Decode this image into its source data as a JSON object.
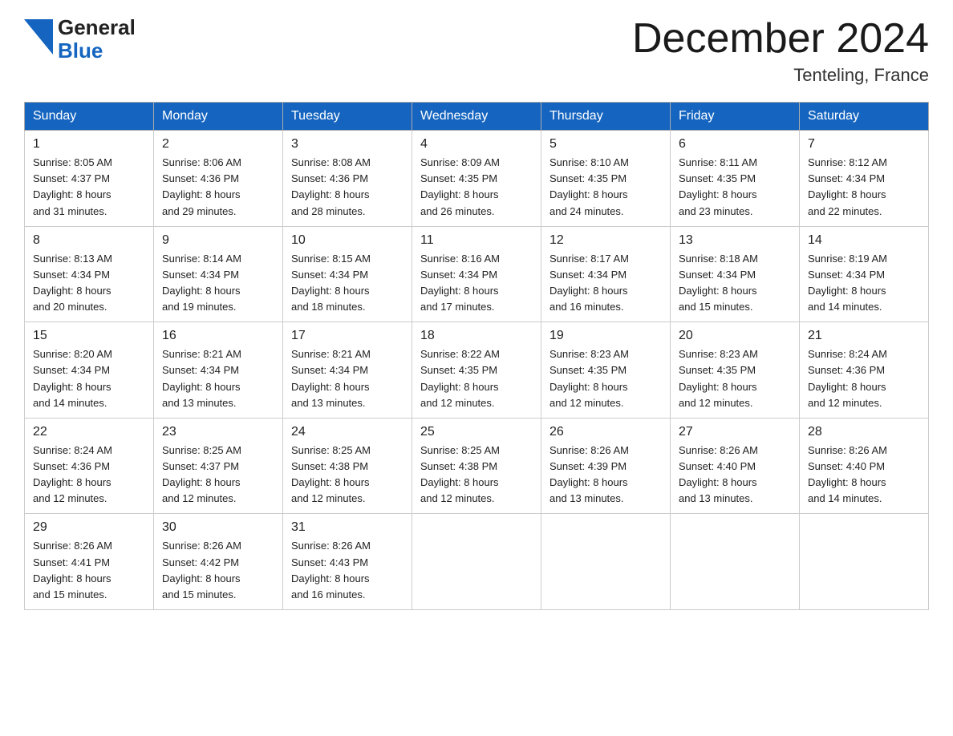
{
  "header": {
    "logo_line1": "General",
    "logo_line2": "Blue",
    "month_title": "December 2024",
    "location": "Tenteling, France"
  },
  "calendar": {
    "headers": [
      "Sunday",
      "Monday",
      "Tuesday",
      "Wednesday",
      "Thursday",
      "Friday",
      "Saturday"
    ],
    "weeks": [
      [
        {
          "day": "1",
          "info": "Sunrise: 8:05 AM\nSunset: 4:37 PM\nDaylight: 8 hours\nand 31 minutes."
        },
        {
          "day": "2",
          "info": "Sunrise: 8:06 AM\nSunset: 4:36 PM\nDaylight: 8 hours\nand 29 minutes."
        },
        {
          "day": "3",
          "info": "Sunrise: 8:08 AM\nSunset: 4:36 PM\nDaylight: 8 hours\nand 28 minutes."
        },
        {
          "day": "4",
          "info": "Sunrise: 8:09 AM\nSunset: 4:35 PM\nDaylight: 8 hours\nand 26 minutes."
        },
        {
          "day": "5",
          "info": "Sunrise: 8:10 AM\nSunset: 4:35 PM\nDaylight: 8 hours\nand 24 minutes."
        },
        {
          "day": "6",
          "info": "Sunrise: 8:11 AM\nSunset: 4:35 PM\nDaylight: 8 hours\nand 23 minutes."
        },
        {
          "day": "7",
          "info": "Sunrise: 8:12 AM\nSunset: 4:34 PM\nDaylight: 8 hours\nand 22 minutes."
        }
      ],
      [
        {
          "day": "8",
          "info": "Sunrise: 8:13 AM\nSunset: 4:34 PM\nDaylight: 8 hours\nand 20 minutes."
        },
        {
          "day": "9",
          "info": "Sunrise: 8:14 AM\nSunset: 4:34 PM\nDaylight: 8 hours\nand 19 minutes."
        },
        {
          "day": "10",
          "info": "Sunrise: 8:15 AM\nSunset: 4:34 PM\nDaylight: 8 hours\nand 18 minutes."
        },
        {
          "day": "11",
          "info": "Sunrise: 8:16 AM\nSunset: 4:34 PM\nDaylight: 8 hours\nand 17 minutes."
        },
        {
          "day": "12",
          "info": "Sunrise: 8:17 AM\nSunset: 4:34 PM\nDaylight: 8 hours\nand 16 minutes."
        },
        {
          "day": "13",
          "info": "Sunrise: 8:18 AM\nSunset: 4:34 PM\nDaylight: 8 hours\nand 15 minutes."
        },
        {
          "day": "14",
          "info": "Sunrise: 8:19 AM\nSunset: 4:34 PM\nDaylight: 8 hours\nand 14 minutes."
        }
      ],
      [
        {
          "day": "15",
          "info": "Sunrise: 8:20 AM\nSunset: 4:34 PM\nDaylight: 8 hours\nand 14 minutes."
        },
        {
          "day": "16",
          "info": "Sunrise: 8:21 AM\nSunset: 4:34 PM\nDaylight: 8 hours\nand 13 minutes."
        },
        {
          "day": "17",
          "info": "Sunrise: 8:21 AM\nSunset: 4:34 PM\nDaylight: 8 hours\nand 13 minutes."
        },
        {
          "day": "18",
          "info": "Sunrise: 8:22 AM\nSunset: 4:35 PM\nDaylight: 8 hours\nand 12 minutes."
        },
        {
          "day": "19",
          "info": "Sunrise: 8:23 AM\nSunset: 4:35 PM\nDaylight: 8 hours\nand 12 minutes."
        },
        {
          "day": "20",
          "info": "Sunrise: 8:23 AM\nSunset: 4:35 PM\nDaylight: 8 hours\nand 12 minutes."
        },
        {
          "day": "21",
          "info": "Sunrise: 8:24 AM\nSunset: 4:36 PM\nDaylight: 8 hours\nand 12 minutes."
        }
      ],
      [
        {
          "day": "22",
          "info": "Sunrise: 8:24 AM\nSunset: 4:36 PM\nDaylight: 8 hours\nand 12 minutes."
        },
        {
          "day": "23",
          "info": "Sunrise: 8:25 AM\nSunset: 4:37 PM\nDaylight: 8 hours\nand 12 minutes."
        },
        {
          "day": "24",
          "info": "Sunrise: 8:25 AM\nSunset: 4:38 PM\nDaylight: 8 hours\nand 12 minutes."
        },
        {
          "day": "25",
          "info": "Sunrise: 8:25 AM\nSunset: 4:38 PM\nDaylight: 8 hours\nand 12 minutes."
        },
        {
          "day": "26",
          "info": "Sunrise: 8:26 AM\nSunset: 4:39 PM\nDaylight: 8 hours\nand 13 minutes."
        },
        {
          "day": "27",
          "info": "Sunrise: 8:26 AM\nSunset: 4:40 PM\nDaylight: 8 hours\nand 13 minutes."
        },
        {
          "day": "28",
          "info": "Sunrise: 8:26 AM\nSunset: 4:40 PM\nDaylight: 8 hours\nand 14 minutes."
        }
      ],
      [
        {
          "day": "29",
          "info": "Sunrise: 8:26 AM\nSunset: 4:41 PM\nDaylight: 8 hours\nand 15 minutes."
        },
        {
          "day": "30",
          "info": "Sunrise: 8:26 AM\nSunset: 4:42 PM\nDaylight: 8 hours\nand 15 minutes."
        },
        {
          "day": "31",
          "info": "Sunrise: 8:26 AM\nSunset: 4:43 PM\nDaylight: 8 hours\nand 16 minutes."
        },
        {
          "day": "",
          "info": ""
        },
        {
          "day": "",
          "info": ""
        },
        {
          "day": "",
          "info": ""
        },
        {
          "day": "",
          "info": ""
        }
      ]
    ]
  }
}
